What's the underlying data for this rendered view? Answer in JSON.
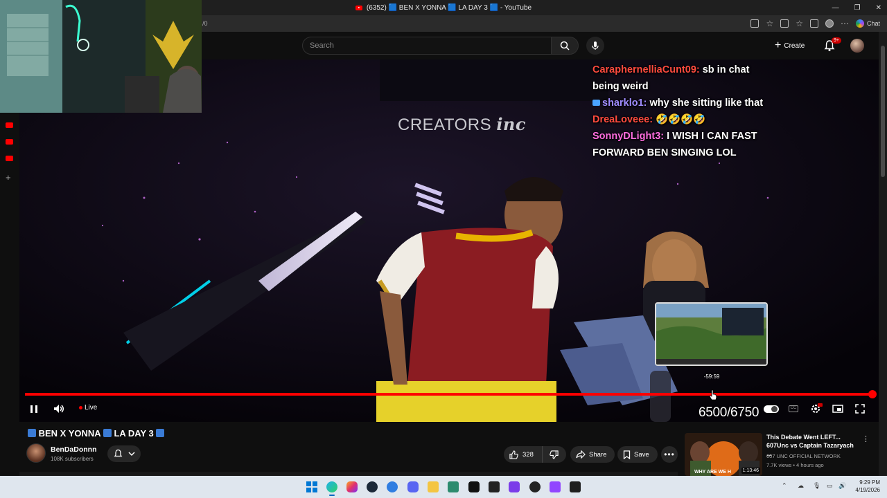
{
  "window": {
    "title": "(6352) 🟦 BEN X YONNA 🟦 LA DAY 3 🟦 - YouTube",
    "address_fragment": "/0",
    "chat_button": "Chat"
  },
  "header": {
    "search_placeholder": "Search",
    "create_label": "Create",
    "notification_badge": "9+"
  },
  "chat_overlay": [
    {
      "user": "CaraphernelliaCunt09:",
      "message": "sb in chat being weird",
      "color": "#ff4b3e"
    },
    {
      "user": "sharklo1:",
      "message": "why she sitting like that",
      "color": "#9f8cff"
    },
    {
      "user": "DreaLoveee:",
      "message": "🤣🤣🤣🤣",
      "color": "#ff4b3e"
    },
    {
      "user": "SonnyDLight3:",
      "message": "I WISH I CAN FAST FORWARD BEN SINGING LOL",
      "color": "#ff6ee0"
    }
  ],
  "video": {
    "watermark": "CREATORS",
    "watermark_script": "inc",
    "seek_preview_time": "-59:59",
    "live_label": "Live",
    "goal_counter": "6500/6750",
    "progress_fraction": 1.0
  },
  "video_info": {
    "title": "BEN X YONNA",
    "title_part2": "LA DAY 3",
    "channel_name": "BenDaDonnn",
    "subscribers": "108K subscribers",
    "likes": "328",
    "share_label": "Share",
    "save_label": "Save"
  },
  "recommendation": {
    "title": "This Debate Went LEFT... 607Unc vs Captain Tazaryach ...",
    "channel": "607 UNC OFFICIAL NETWORK",
    "meta": "7.7K views • 4 hours ago",
    "duration": "1:13:46",
    "thumb_caption": "WHY ARE WE H"
  },
  "taskbar": {
    "time": "9:29 PM",
    "date": "4/19/2026"
  },
  "colors": {
    "youtube_red": "#ff0000",
    "background": "#0f0f0f",
    "title_square": "#3a7bd5"
  }
}
